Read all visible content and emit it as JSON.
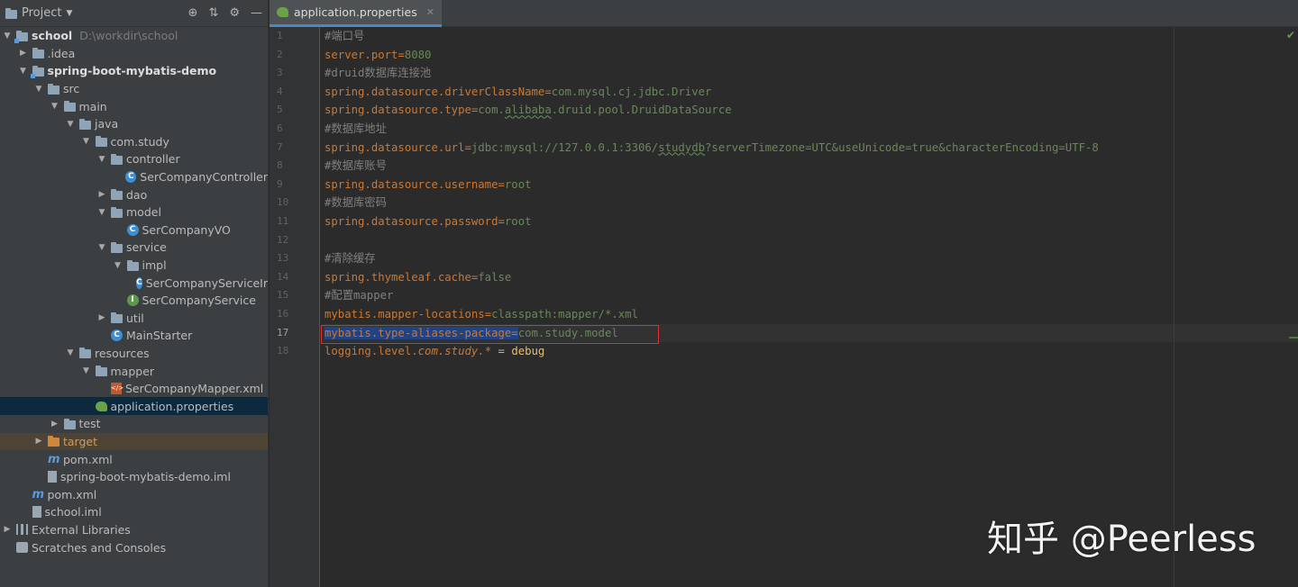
{
  "panel": {
    "title": "Project",
    "icons": [
      "locate-icon",
      "collapse-icon",
      "settings-icon",
      "hide-icon"
    ]
  },
  "tree": [
    {
      "label": "school",
      "path": "D:\\workdir\\school",
      "depth": 0,
      "arrow": "down",
      "icon": "module-folder",
      "bold": true
    },
    {
      "label": ".idea",
      "depth": 1,
      "arrow": "right",
      "icon": "folder"
    },
    {
      "label": "spring-boot-mybatis-demo",
      "depth": 1,
      "arrow": "down",
      "icon": "module-folder",
      "bold": true
    },
    {
      "label": "src",
      "depth": 2,
      "arrow": "down",
      "icon": "folder"
    },
    {
      "label": "main",
      "depth": 3,
      "arrow": "down",
      "icon": "folder"
    },
    {
      "label": "java",
      "depth": 4,
      "arrow": "down",
      "icon": "folder"
    },
    {
      "label": "com.study",
      "depth": 5,
      "arrow": "down",
      "icon": "folder"
    },
    {
      "label": "controller",
      "depth": 6,
      "arrow": "down",
      "icon": "folder"
    },
    {
      "label": "SerCompanyController",
      "depth": 7,
      "arrow": "",
      "icon": "class"
    },
    {
      "label": "dao",
      "depth": 6,
      "arrow": "right",
      "icon": "folder"
    },
    {
      "label": "model",
      "depth": 6,
      "arrow": "down",
      "icon": "folder"
    },
    {
      "label": "SerCompanyVO",
      "depth": 7,
      "arrow": "",
      "icon": "class"
    },
    {
      "label": "service",
      "depth": 6,
      "arrow": "down",
      "icon": "folder"
    },
    {
      "label": "impl",
      "depth": 7,
      "arrow": "down",
      "icon": "folder"
    },
    {
      "label": "SerCompanyServiceIr",
      "depth": 8,
      "arrow": "",
      "icon": "class"
    },
    {
      "label": "SerCompanyService",
      "depth": 7,
      "arrow": "",
      "icon": "interface"
    },
    {
      "label": "util",
      "depth": 6,
      "arrow": "right",
      "icon": "folder"
    },
    {
      "label": "MainStarter",
      "depth": 6,
      "arrow": "",
      "icon": "class"
    },
    {
      "label": "resources",
      "depth": 4,
      "arrow": "down",
      "icon": "folder"
    },
    {
      "label": "mapper",
      "depth": 5,
      "arrow": "down",
      "icon": "folder"
    },
    {
      "label": "SerCompanyMapper.xml",
      "depth": 6,
      "arrow": "",
      "icon": "xml"
    },
    {
      "label": "application.properties",
      "depth": 5,
      "arrow": "",
      "icon": "properties",
      "selected": true
    },
    {
      "label": "test",
      "depth": 3,
      "arrow": "right",
      "icon": "folder"
    },
    {
      "label": "target",
      "depth": 2,
      "arrow": "right",
      "icon": "folder-orange",
      "target": true
    },
    {
      "label": "pom.xml",
      "depth": 2,
      "arrow": "",
      "icon": "maven"
    },
    {
      "label": "spring-boot-mybatis-demo.iml",
      "depth": 2,
      "arrow": "",
      "icon": "iml"
    },
    {
      "label": "pom.xml",
      "depth": 1,
      "arrow": "",
      "icon": "maven"
    },
    {
      "label": "school.iml",
      "depth": 1,
      "arrow": "",
      "icon": "iml"
    },
    {
      "label": "External Libraries",
      "depth": 0,
      "arrow": "right",
      "icon": "library"
    },
    {
      "label": "Scratches and Consoles",
      "depth": 0,
      "arrow": "",
      "icon": "scratch"
    }
  ],
  "editor": {
    "tab_label": "application.properties",
    "current_line": 17,
    "lines": [
      "#端口号",
      "server.port=8080",
      "#druid数据库连接池",
      "spring.datasource.driverClassName=com.mysql.cj.jdbc.Driver",
      "spring.datasource.type=com.alibaba.druid.pool.DruidDataSource",
      "#数据库地址",
      "spring.datasource.url=jdbc:mysql://127.0.0.1:3306/studydb?serverTimezone=UTC&useUnicode=true&characterEncoding=UTF-8",
      "#数据库账号",
      "spring.datasource.username=root",
      "#数据库密码",
      "spring.datasource.password=root",
      "",
      "#清除缓存",
      "spring.thymeleaf.cache=false",
      "#配置mapper",
      "mybatis.mapper-locations=classpath:mapper/*.xml",
      "mybatis.type-aliases-package=com.study.model",
      "logging.level.com.study.* = debug"
    ]
  },
  "watermark": "知乎 @Peerless"
}
